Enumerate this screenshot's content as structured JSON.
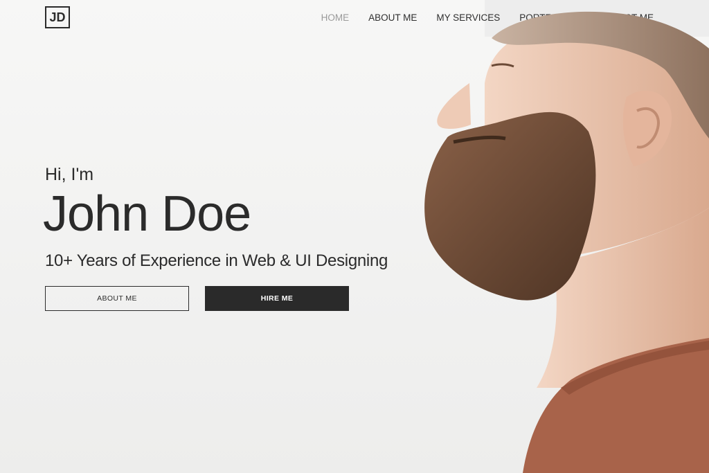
{
  "brand": {
    "logo_text": "JD"
  },
  "nav": {
    "items": [
      {
        "label": "HOME",
        "active": true
      },
      {
        "label": "ABOUT ME",
        "active": false
      },
      {
        "label": "MY SERVICES",
        "active": false
      },
      {
        "label": "PORTFOLIO",
        "active": false
      },
      {
        "label": "CONTACT ME",
        "active": false
      }
    ]
  },
  "hero": {
    "greeting": "Hi, I'm",
    "name": "John Doe",
    "tagline": "10+ Years of Experience in Web & UI Designing",
    "about_button_label": "ABOUT ME",
    "hire_button_label": "HIRE ME"
  },
  "colors": {
    "text": "#2b2b2b",
    "nav_active": "#9a9a9a",
    "button_dark": "#2a2a2a",
    "shirt": "#a8634a",
    "skin": "#e8c3ad",
    "beard": "#6b4a36"
  },
  "images": {
    "portrait": "bearded-man-profile-photo"
  }
}
